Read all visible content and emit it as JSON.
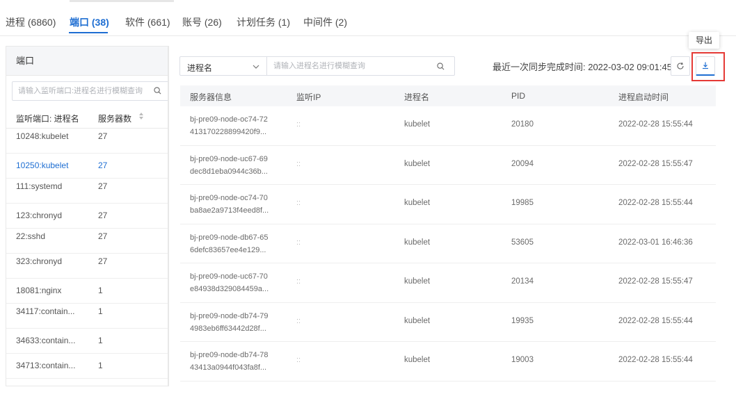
{
  "tabs": [
    {
      "label": "进程 (6860)"
    },
    {
      "label": "端口 (38)"
    },
    {
      "label": "软件 (661)"
    },
    {
      "label": "账号 (26)"
    },
    {
      "label": "计划任务 (1)"
    },
    {
      "label": "中间件 (2)"
    }
  ],
  "tooltip": "导出",
  "left_panel": {
    "title": "端口",
    "search_placeholder": "请输入监听端口:进程名进行模糊查询",
    "col_port": "监听端口: 进程名",
    "col_count": "服务器数",
    "rows": [
      {
        "port": "10248:kubelet",
        "count": "27"
      },
      {
        "port": "10250:kubelet",
        "count": "27"
      },
      {
        "port": "111:systemd",
        "count": "27"
      },
      {
        "port": "123:chronyd",
        "count": "27"
      },
      {
        "port": "22:sshd",
        "count": "27"
      },
      {
        "port": "323:chronyd",
        "count": "27"
      },
      {
        "port": "18081:nginx",
        "count": "1"
      },
      {
        "port": "34117:contain...",
        "count": "1"
      },
      {
        "port": "34633:contain...",
        "count": "1"
      },
      {
        "port": "34713:contain...",
        "count": "1"
      }
    ]
  },
  "filter": {
    "select_value": "进程名",
    "search_placeholder": "请输入进程名进行模糊查询"
  },
  "sync": {
    "text": "最近一次同步完成时间: 2022-03-02 09:01:45"
  },
  "table": {
    "headers": [
      "服务器信息",
      "监听IP",
      "进程名",
      "PID",
      "进程启动时间"
    ],
    "rows": [
      {
        "srv1": "bj-pre09-node-oc74-72",
        "srv2": "413170228899420f9...",
        "ip": "::",
        "proc": "kubelet",
        "pid": "20180",
        "time": "2022-02-28 15:55:44"
      },
      {
        "srv1": "bj-pre09-node-uc67-69",
        "srv2": "dec8d1eba0944c36b...",
        "ip": "::",
        "proc": "kubelet",
        "pid": "20094",
        "time": "2022-02-28 15:55:47"
      },
      {
        "srv1": "bj-pre09-node-oc74-70",
        "srv2": "ba8ae2a9713f4eed8f...",
        "ip": "::",
        "proc": "kubelet",
        "pid": "19985",
        "time": "2022-02-28 15:55:44"
      },
      {
        "srv1": "bj-pre09-node-db67-65",
        "srv2": "6defc83657ee4e129...",
        "ip": "::",
        "proc": "kubelet",
        "pid": "53605",
        "time": "2022-03-01 16:46:36"
      },
      {
        "srv1": "bj-pre09-node-uc67-70",
        "srv2": "e84938d329084459a...",
        "ip": "::",
        "proc": "kubelet",
        "pid": "20134",
        "time": "2022-02-28 15:55:47"
      },
      {
        "srv1": "bj-pre09-node-db74-79",
        "srv2": "4983eb6ff63442d28f...",
        "ip": "::",
        "proc": "kubelet",
        "pid": "19935",
        "time": "2022-02-28 15:55:44"
      },
      {
        "srv1": "bj-pre09-node-db74-78",
        "srv2": "43413a0944f043fa8f...",
        "ip": "::",
        "proc": "kubelet",
        "pid": "19003",
        "time": "2022-02-28 15:55:44"
      }
    ]
  },
  "colors": {
    "accent": "#1e6ed2",
    "highlight": "#e53935"
  },
  "icons": {
    "search": "search-icon",
    "chevron": "chevron-down-icon",
    "refresh": "refresh-icon",
    "export": "download-icon",
    "sort": "sort-icon"
  }
}
